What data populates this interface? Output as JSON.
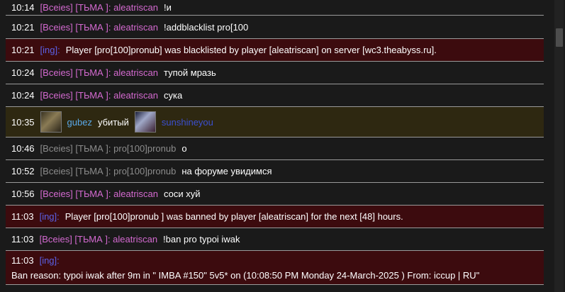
{
  "rows": [
    {
      "time": "10:14",
      "channel": "[Bceies] [ТЬМА ]: aleatriscan",
      "message": "!и"
    },
    {
      "time": "10:21",
      "channel": "[Bceies] [ТЬМА ]: aleatriscan",
      "message": "!addblacklist pro[100"
    },
    {
      "time": "10:21",
      "system": "[ing]:",
      "message": "Player [pro[100]pronub] was blacklisted by player [aleatriscan] on server [wc3.theabyss.ru]."
    },
    {
      "time": "10:24",
      "channel": "[Bceies] [ТЬМА ]: aleatriscan",
      "message": "тупой мразь"
    },
    {
      "time": "10:24",
      "channel": "[Bceies] [ТЬМА ]: aleatriscan",
      "message": "сука"
    },
    {
      "time": "10:35",
      "killer": "gubez",
      "verb": "убитый",
      "victim": "sunshineyou"
    },
    {
      "time": "10:46",
      "channel": "[Bceies] [ТЬМА ]: pro[100]pronub",
      "message": "о"
    },
    {
      "time": "10:52",
      "channel": "[Bceies] [ТЬМА ]: pro[100]pronub",
      "message": "на форуме увидимся"
    },
    {
      "time": "10:56",
      "channel": "[Bceies] [ТЬМА ]: aleatriscan",
      "message": "соси хуй"
    },
    {
      "time": "11:03",
      "system": "[ing]:",
      "message": "Player [pro[100]pronub ] was banned by player [aleatriscan] for the next [48] hours."
    },
    {
      "time": "11:03",
      "channel": "[Bceies] [ТЬМА ]: aleatriscan",
      "message": "!ban pro typoi iwak"
    },
    {
      "time": "11:03",
      "system": "[ing]:",
      "message": "Ban reason: typoi iwak after 9m in \" IMBA #150\" 5v5* on (10:08:50 PM Monday 24-March-2025 ) From: iccup | RU\""
    }
  ],
  "colors": {
    "channel_pink": "#d46ad0",
    "channel_grey": "#8c8c8c",
    "system_blue": "#5b61e8",
    "system_row_bg": "#3c0b0e",
    "kill_row_bg": "#2e2811"
  },
  "icons": {
    "killer_avatar": "hero-portrait-icon",
    "victim_avatar": "hero-portrait-icon"
  }
}
